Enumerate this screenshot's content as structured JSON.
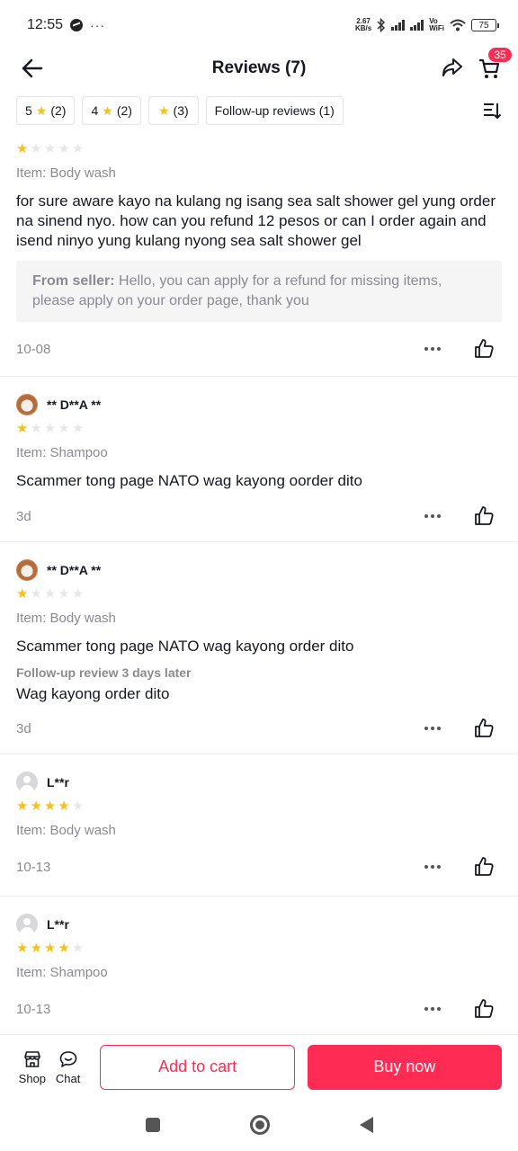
{
  "status_bar": {
    "time": "12:55",
    "more": "···",
    "net_speed_value": "2.67",
    "net_speed_unit": "KB/s",
    "vowifi_top": "Vo",
    "vowifi_bottom": "WiFi",
    "battery": "75"
  },
  "header": {
    "title": "Reviews (7)",
    "cart_count": "35"
  },
  "filters": [
    {
      "label": "5",
      "has_star": true,
      "count": "(2)"
    },
    {
      "label": "4",
      "has_star": true,
      "count": "(2)"
    },
    {
      "label": "",
      "has_star": true,
      "count": "(3)"
    },
    {
      "label": "Follow-up reviews",
      "has_star": false,
      "count": "(1)"
    }
  ],
  "reviews": [
    {
      "name": "",
      "rating": 1,
      "item": "Item: Body wash",
      "text": "for sure aware kayo na kulang ng isang sea salt shower gel yung order na sinend nyo. how can you refund 12 pesos or can I order again and isend ninyo yung kulang nyong sea salt shower gel",
      "seller_label": "From seller:",
      "seller_reply": "Hello, you can apply for a refund for missing items, please apply on your order page, thank you",
      "date": "10-08"
    },
    {
      "name": "** D**A **",
      "rating": 1,
      "item": "Item: Shampoo",
      "text": "Scammer tong page NATO wag kayong oorder dito",
      "date": "3d"
    },
    {
      "name": "** D**A **",
      "rating": 1,
      "item": "Item: Body wash",
      "text": "Scammer tong page NATO wag kayong order dito",
      "followup_label": "Follow-up review 3 days later",
      "followup_text": "Wag kayong order dito",
      "date": "3d"
    },
    {
      "name": "L**r",
      "rating": 4,
      "item": "Item: Body wash",
      "date": "10-13"
    },
    {
      "name": "L**r",
      "rating": 4,
      "item": "Item: Shampoo",
      "date": "10-13"
    }
  ],
  "bottom_bar": {
    "shop_label": "Shop",
    "chat_label": "Chat",
    "add_to_cart": "Add to cart",
    "buy_now": "Buy now"
  },
  "colors": {
    "accent": "#fe2c55",
    "star": "#f4c11f",
    "muted_text": "#8a8b91"
  },
  "icons": [
    "back-arrow-icon",
    "share-icon",
    "cart-icon",
    "sort-icon",
    "more-dots-icon",
    "thumbs-up-icon",
    "shop-icon",
    "chat-icon"
  ]
}
